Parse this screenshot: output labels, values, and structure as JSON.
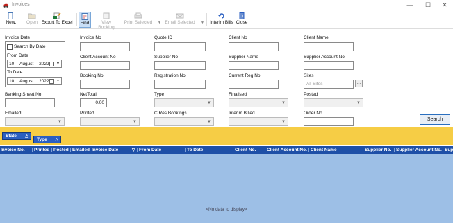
{
  "window": {
    "title": "Invoices",
    "icon": "red-car-icon",
    "minimize": "—",
    "maximize": "☐",
    "close": "✕"
  },
  "toolbar": {
    "new": "New",
    "open": "Open",
    "export": "Export To Excel",
    "find": "Find",
    "view_booking": "View Booking",
    "print_selected": "Print Selected",
    "email_selected": "Email Selected",
    "interim_bills": "Interim Bills",
    "close": "Close"
  },
  "filters": {
    "invoice_date_label": "Invoice Date",
    "search_by_date": "Search By Date",
    "from_date_label": "From Date",
    "from_date": {
      "day": "10",
      "month": "August",
      "year": "2022"
    },
    "to_date_label": "To Date",
    "to_date": {
      "day": "10",
      "month": "August",
      "year": "2022"
    },
    "invoice_no": "Invoice No",
    "quote_id": "Quote ID",
    "client_no": "Client No",
    "client_name": "Client Name",
    "client_account_no": "Client Account No",
    "supplier_no": "Supplier No",
    "supplier_name": "Supplier Name",
    "supplier_account_no": "Supplier Account No",
    "booking_no": "Booking No",
    "registration_no": "Registration No",
    "current_reg_no": "Current Reg No",
    "sites": "Sites",
    "sites_value": "All Sites",
    "sites_browse": "...",
    "banking_sheet_no": "Banking Sheet No.",
    "net_total": "NetTotal",
    "net_total_value": "0.00",
    "type": "Type",
    "finalised": "Finalised",
    "posted": "Posted",
    "emailed": "Emailed",
    "printed": "Printed",
    "cres_bookings": "C.Res Bookings",
    "interim_billed": "Interim Billed",
    "order_no": "Order No",
    "search_button": "Search"
  },
  "group_panel": {
    "chips": [
      "State",
      "Type"
    ]
  },
  "grid": {
    "columns": [
      "Invoice No.",
      "Printed",
      "Posted",
      "Emailed",
      "Invoice Date",
      "From Date",
      "To Date",
      "Client No.",
      "Client Account No.",
      "Client Name",
      "Supplier No.",
      "Supplier Account No.",
      "Supp"
    ],
    "empty_text": "<No data to display>"
  },
  "colors": {
    "group_bar": "#f6cd45",
    "grid_header": "#1e4fa7",
    "grid_body": "#9dbfe6",
    "chip": "#2b5fc1"
  }
}
